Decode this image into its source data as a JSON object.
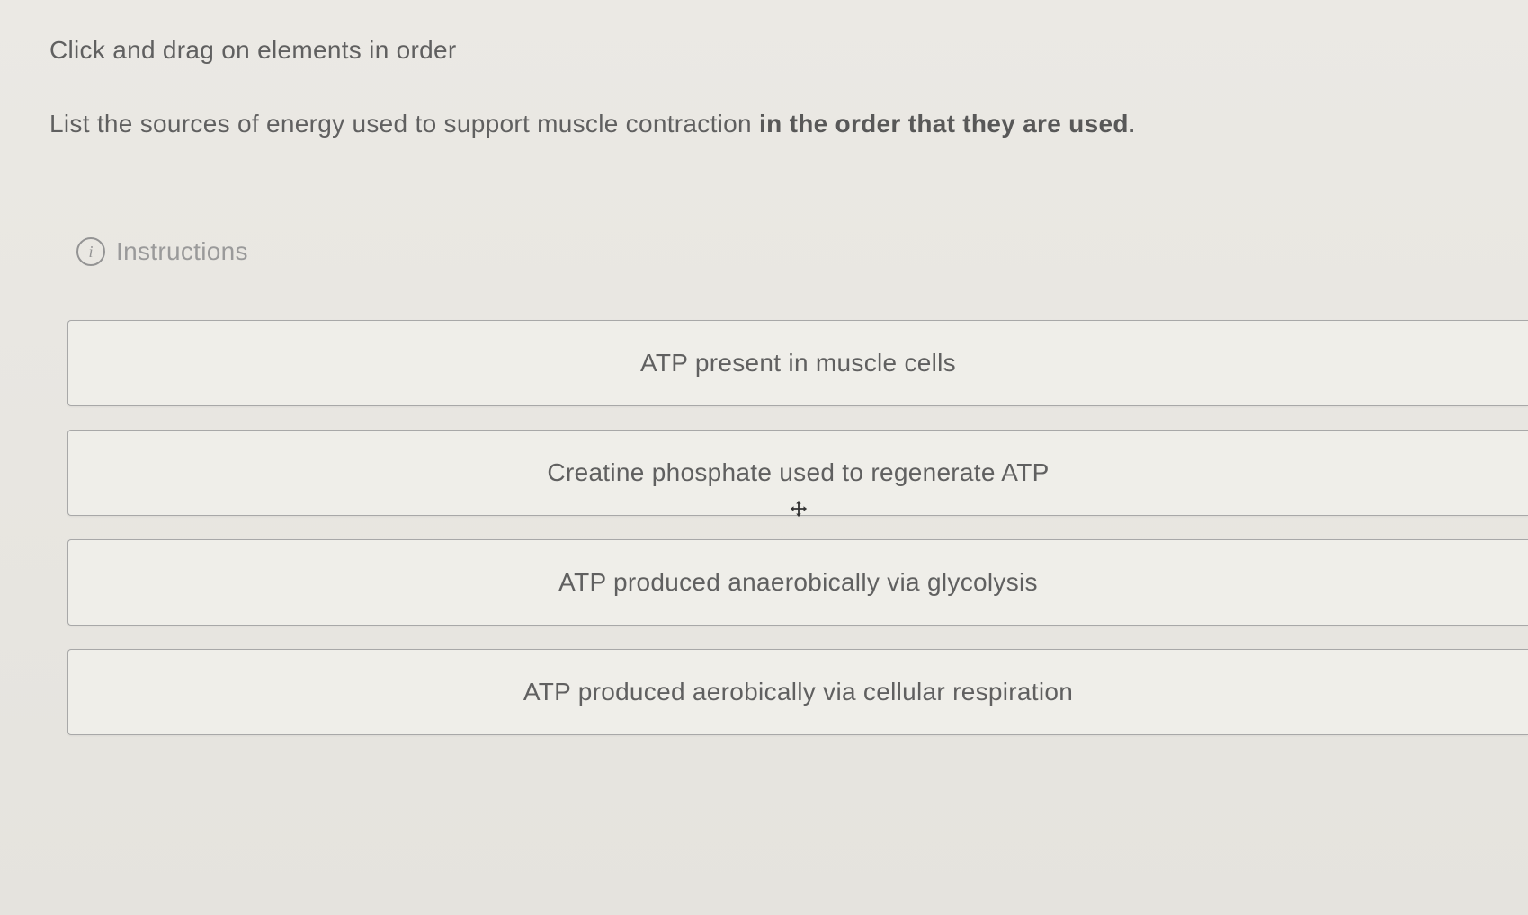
{
  "header": {
    "instruction_text": "Click and drag on elements in order"
  },
  "question": {
    "prefix": "List the sources of energy used to support muscle contraction ",
    "bold_part": "in the order that they are used",
    "suffix": "."
  },
  "instructions": {
    "label": "Instructions",
    "icon_glyph": "i"
  },
  "items": [
    {
      "label": "ATP present in muscle cells",
      "show_cursor": false
    },
    {
      "label": "Creatine phosphate used to regenerate ATP",
      "show_cursor": true
    },
    {
      "label": "ATP produced anaerobically via glycolysis",
      "show_cursor": false
    },
    {
      "label": "ATP produced aerobically via cellular respiration",
      "show_cursor": false
    }
  ]
}
